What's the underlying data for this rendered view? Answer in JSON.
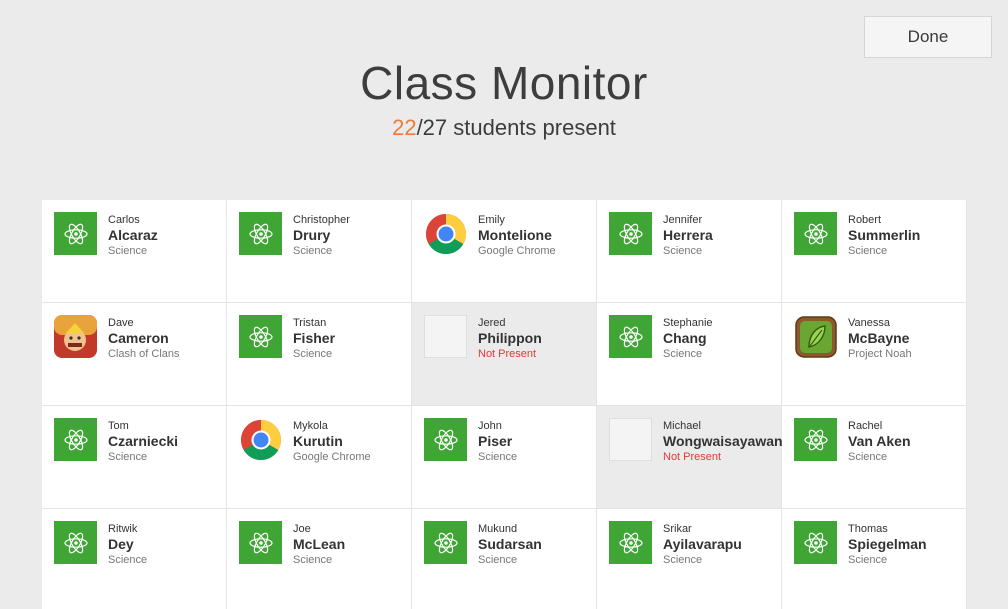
{
  "header": {
    "title": "Class Monitor",
    "present_count": "22",
    "present_rest": "/27 students present",
    "done_label": "Done"
  },
  "colors": {
    "present_accent": "#f07a3a",
    "science_green": "#3fa535",
    "not_present_red": "#e53935"
  },
  "students": [
    {
      "first": "Carlos",
      "last": "Alcaraz",
      "app": "Science",
      "icon": "science-atom-icon"
    },
    {
      "first": "Christopher",
      "last": "Drury",
      "app": "Science",
      "icon": "science-atom-icon"
    },
    {
      "first": "Emily",
      "last": "Montelione",
      "app": "Google Chrome",
      "icon": "chrome-icon"
    },
    {
      "first": "Jennifer",
      "last": "Herrera",
      "app": "Science",
      "icon": "science-atom-icon"
    },
    {
      "first": "Robert",
      "last": "Summerlin",
      "app": "Science",
      "icon": "science-atom-icon"
    },
    {
      "first": "Dave",
      "last": "Cameron",
      "app": "Clash of Clans",
      "icon": "clash-of-clans-icon"
    },
    {
      "first": "Tristan",
      "last": "Fisher",
      "app": "Science",
      "icon": "science-atom-icon"
    },
    {
      "first": "Jered",
      "last": "Philippon",
      "app": "Not Present",
      "icon": "blank-icon"
    },
    {
      "first": "Stephanie",
      "last": "Chang",
      "app": "Science",
      "icon": "science-atom-icon"
    },
    {
      "first": "Vanessa",
      "last": "McBayne",
      "app": "Project Noah",
      "icon": "project-noah-icon"
    },
    {
      "first": "Tom",
      "last": "Czarniecki",
      "app": "Science",
      "icon": "science-atom-icon"
    },
    {
      "first": "Mykola",
      "last": "Kurutin",
      "app": "Google Chrome",
      "icon": "chrome-icon"
    },
    {
      "first": "John",
      "last": "Piser",
      "app": "Science",
      "icon": "science-atom-icon"
    },
    {
      "first": "Michael",
      "last": "Wongwaisayawan",
      "app": "Not Present",
      "icon": "blank-icon"
    },
    {
      "first": "Rachel",
      "last": "Van Aken",
      "app": "Science",
      "icon": "science-atom-icon"
    },
    {
      "first": "Ritwik",
      "last": "Dey",
      "app": "Science",
      "icon": "science-atom-icon"
    },
    {
      "first": "Joe",
      "last": "McLean",
      "app": "Science",
      "icon": "science-atom-icon"
    },
    {
      "first": "Mukund",
      "last": "Sudarsan",
      "app": "Science",
      "icon": "science-atom-icon"
    },
    {
      "first": "Srikar",
      "last": "Ayilavarapu",
      "app": "Science",
      "icon": "science-atom-icon"
    },
    {
      "first": "Thomas",
      "last": "Spiegelman",
      "app": "Science",
      "icon": "science-atom-icon"
    }
  ]
}
